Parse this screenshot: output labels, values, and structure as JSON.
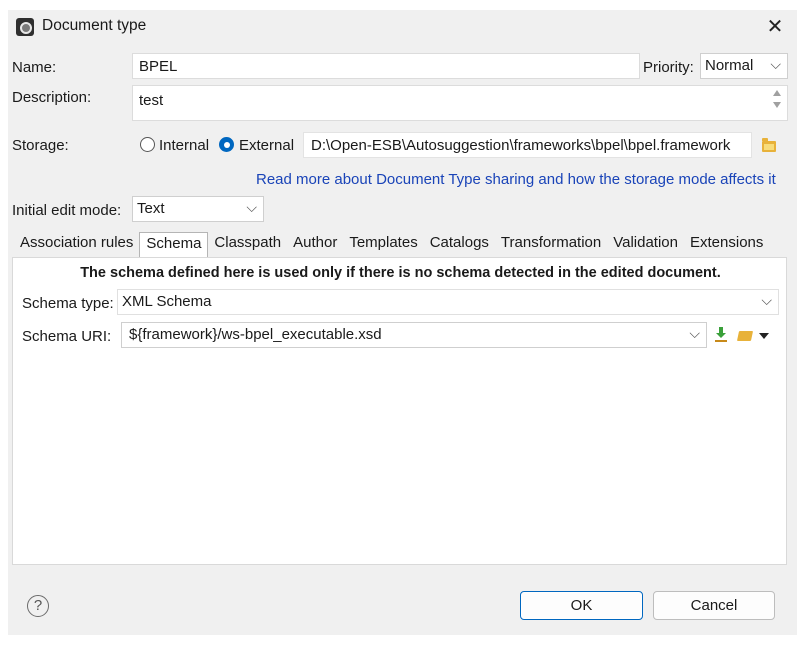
{
  "window": {
    "title": "Document type",
    "close_glyph": "✕"
  },
  "form": {
    "name_label": "Name:",
    "name_value": "BPEL",
    "priority_label": "Priority:",
    "priority_value": "Normal",
    "description_label": "Description:",
    "description_value": "test",
    "storage_label": "Storage:",
    "storage_internal": "Internal",
    "storage_external": "External",
    "storage_selected": "External",
    "storage_path": "D:\\Open-ESB\\Autosuggestion\\frameworks\\bpel\\bpel.framework",
    "sharing_link": "Read more about Document Type sharing and how the storage mode affects it",
    "edit_mode_label": "Initial edit mode:",
    "edit_mode_value": "Text"
  },
  "tabs": [
    {
      "label": "Association rules",
      "active": false
    },
    {
      "label": "Schema",
      "active": true
    },
    {
      "label": "Classpath",
      "active": false
    },
    {
      "label": "Author",
      "active": false
    },
    {
      "label": "Templates",
      "active": false
    },
    {
      "label": "Catalogs",
      "active": false
    },
    {
      "label": "Transformation",
      "active": false
    },
    {
      "label": "Validation",
      "active": false
    },
    {
      "label": "Extensions",
      "active": false
    }
  ],
  "schema": {
    "notice": "The schema defined here is used only if there is no schema detected in the edited document.",
    "type_label": "Schema type:",
    "type_value": "XML Schema",
    "uri_label": "Schema URI:",
    "uri_value": "${framework}/ws-bpel_executable.xsd"
  },
  "footer": {
    "help_glyph": "?",
    "ok_label": "OK",
    "cancel_label": "Cancel"
  },
  "icons": {
    "window_icon": "window-app-icon",
    "close": "close-icon",
    "browse_folder": "folder-icon",
    "download": "download-icon",
    "open_folder": "open-folder-icon",
    "menu_arrow": "dropdown-arrow-icon",
    "help": "help-icon"
  },
  "colors": {
    "accent": "#0067c0",
    "link": "#1a44b8",
    "download_green": "#3aa03a",
    "folder_yellow": "#e8b23a"
  }
}
